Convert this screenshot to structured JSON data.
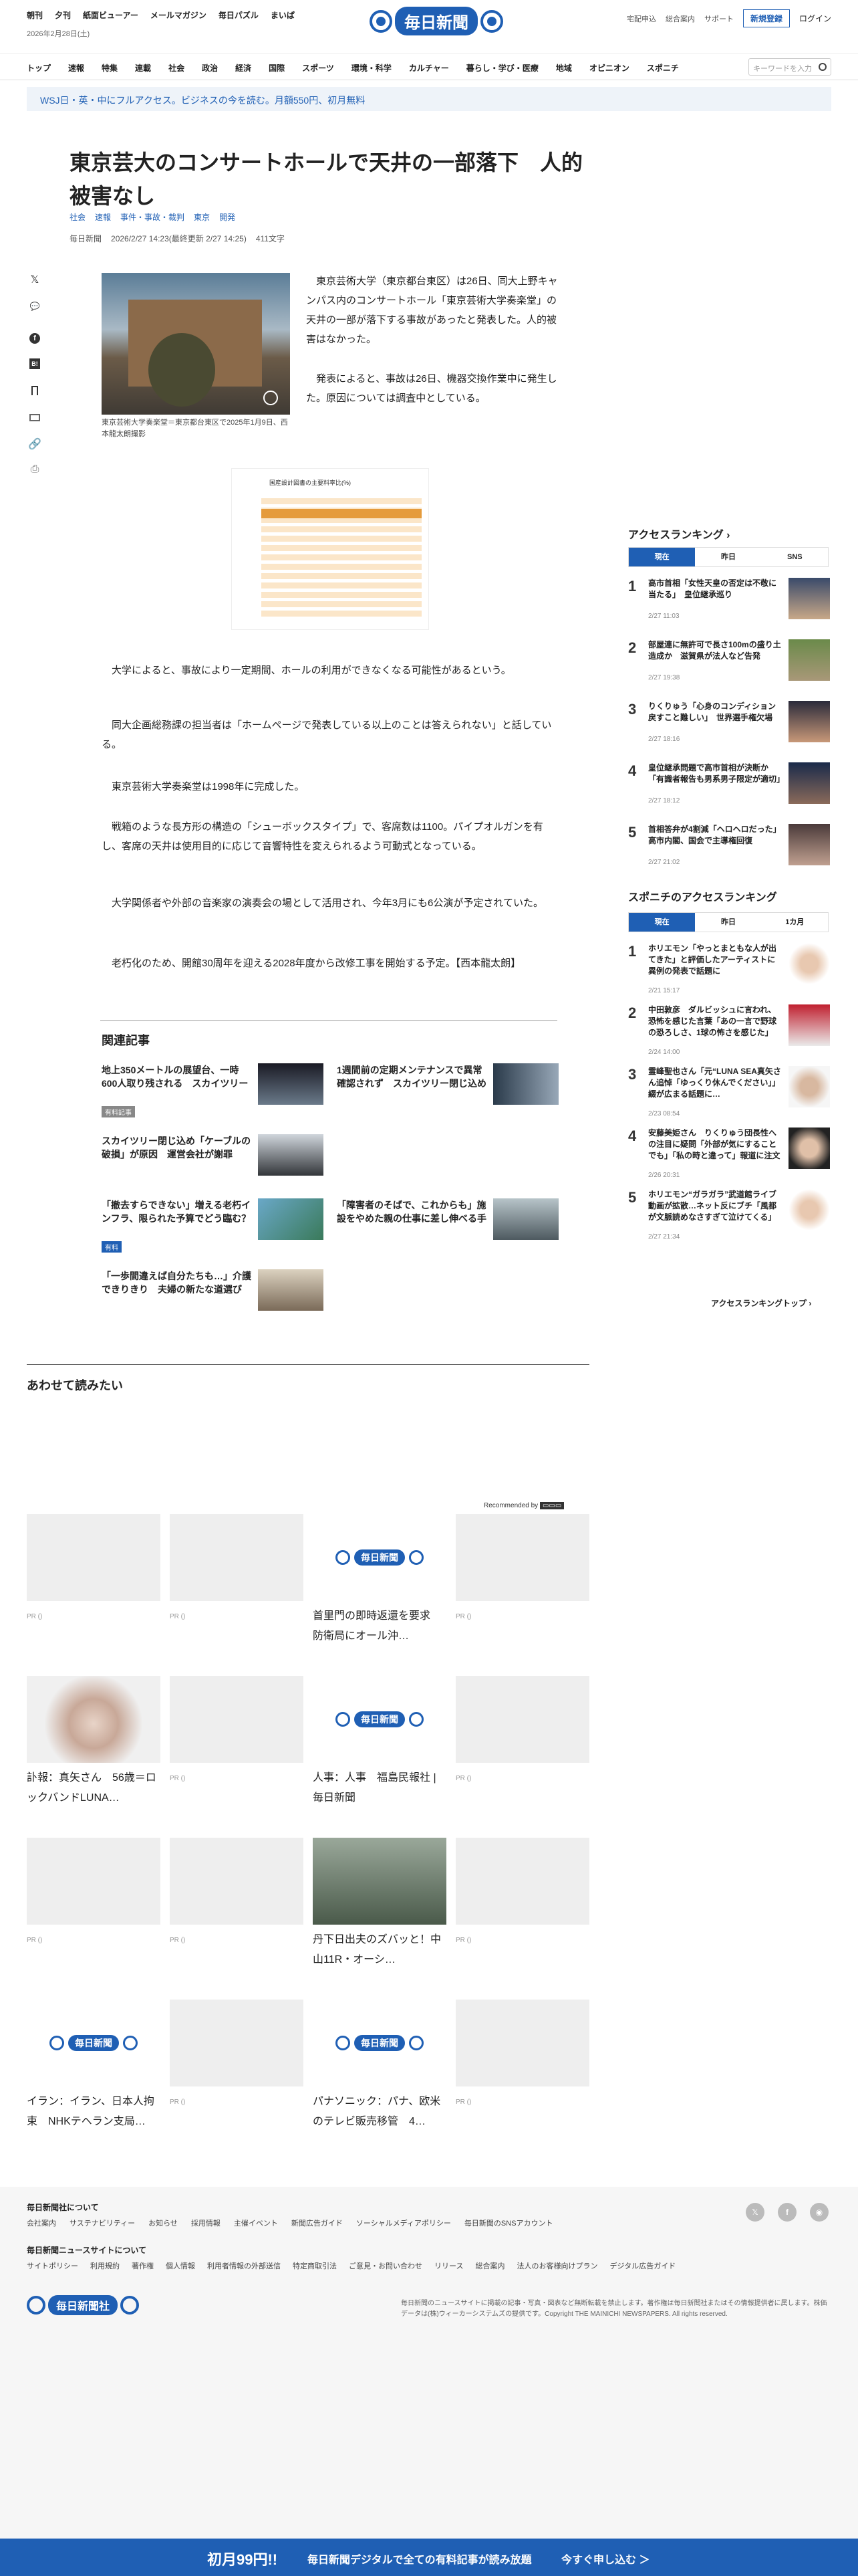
{
  "header": {
    "top_links": [
      "朝刊",
      "夕刊",
      "紙面ビューアー",
      "メールマガジン",
      "毎日パズル",
      "まいぱ"
    ],
    "date": "2026年2月28日(土)",
    "logo_text": "毎日新聞",
    "right_links": [
      "宅配申込",
      "総合案内",
      "サポート"
    ],
    "register": "新規登録",
    "login": "ログイン"
  },
  "nav": {
    "items": [
      "トップ",
      "速報",
      "特集",
      "連載",
      "社会",
      "政治",
      "経済",
      "国際",
      "スポーツ",
      "環境・科学",
      "カルチャー",
      "暮らし・学び・医療",
      "地域",
      "オピニオン",
      "スポニチ"
    ],
    "search_placeholder": "キーワードを入力"
  },
  "banner": "WSJ日・英・中にフルアクセス。ビジネスの今を読む。月額550円、初月無料",
  "article": {
    "title": "東京芸大のコンサートホールで天井の一部落下　人的被害なし",
    "tags": [
      "社会",
      "速報",
      "事件・事故・裁判",
      "東京",
      "開発"
    ],
    "meta": [
      "毎日新聞",
      "2026/2/27 14:23(最終更新 2/27 14:25)",
      "411文字"
    ],
    "share_icons": [
      "x-icon",
      "comment-icon",
      "facebook-icon",
      "hatena-icon",
      "bookmark-icon",
      "mail-icon",
      "link-icon",
      "print-icon"
    ],
    "photo_caption": "東京芸術大学奏楽堂＝東京都台東区で2025年1月9日、西本龍太朗撮影",
    "lead": "　東京芸術大学（東京都台東区）は26日、同大上野キャンパス内のコンサートホール「東京芸術大学奏楽堂」の天井の一部が落下する事故があったと発表した。人的被害はなかった。",
    "p2": "　発表によると、事故は26日、機器交換作業中に発生した。原因については調査中としている。",
    "table_title": "国産設計図書の主要料率比(%)",
    "body": [
      "　大学によると、事故により一定期間、ホールの利用ができなくなる可能性があるという。",
      "　同大企画総務課の担当者は「ホームページで発表している以上のことは答えられない」と話している。",
      "　東京芸術大学奏楽堂は1998年に完成した。",
      "　戦箱のような長方形の構造の「シューボックスタイプ」で、客席数は1100。パイプオルガンを有し、客席の天井は使用目的に応じて音響特性を変えられるよう可動式となっている。",
      "　大学関係者や外部の音楽家の演奏会の場として活用され、今年3月にも6公演が予定されていた。",
      "　老朽化のため、開館30周年を迎える2028年度から改修工事を開始する予定。【西本龍太朗】"
    ]
  },
  "related": {
    "heading": "関連記事",
    "items": [
      {
        "title": "地上350メートルの展望台、一時600人取り残される　スカイツリー",
        "badge": "有料記事"
      },
      {
        "title": "1週間前の定期メンテナンスで異常確認されず　スカイツリー閉じ込め",
        "badge": ""
      },
      {
        "title": "スカイツリー閉じ込め「ケーブルの破損」が原因　運営会社が謝罪",
        "badge": ""
      },
      {
        "title": "「撤去すらできない」増える老朽インフラ、限られた予算でどう臨む？",
        "badge": "有料"
      },
      {
        "title": "「障害者のそばで、これからも」施設をやめた親の仕事に差し伸べる手",
        "badge": ""
      },
      {
        "title": "「一歩間違えば自分たちも…」介護できりきり　夫婦の新たな道選び",
        "badge": ""
      }
    ]
  },
  "recommend": {
    "heading": "あわせて読みたい",
    "powered": "Recommended by",
    "cards": [
      {
        "title": "",
        "pr": "PR ()",
        "kind": "blank"
      },
      {
        "title": "",
        "pr": "PR ()",
        "kind": "blank"
      },
      {
        "title": "首里門の即時返還を要求　防衛局にオール沖…",
        "pr": "",
        "kind": "logo"
      },
      {
        "title": "",
        "pr": "PR ()",
        "kind": "blank"
      },
      {
        "title": "訃報：真矢さん　56歳＝ロックバンドLUNA…",
        "pr": "",
        "kind": "photo-man"
      },
      {
        "title": "",
        "pr": "PR ()",
        "kind": "blank"
      },
      {
        "title": "人事：人事　福島民報社 | 毎日新聞",
        "pr": "",
        "kind": "logo"
      },
      {
        "title": "",
        "pr": "PR ()",
        "kind": "blank"
      },
      {
        "title": "",
        "pr": "PR ()",
        "kind": "blank"
      },
      {
        "title": "",
        "pr": "PR ()",
        "kind": "blank"
      },
      {
        "title": "丹下日出夫のズバッと！中山11R・オーシ…",
        "pr": "",
        "kind": "photo-horse"
      },
      {
        "title": "",
        "pr": "PR ()",
        "kind": "blank"
      },
      {
        "title": "イラン：イラン、日本人拘束　NHKテヘラン支局…",
        "pr": "",
        "kind": "logo"
      },
      {
        "title": "",
        "pr": "PR ()",
        "kind": "blank"
      },
      {
        "title": "パナソニック：パナ、欧米のテレビ販売移管　4…",
        "pr": "",
        "kind": "logo"
      },
      {
        "title": "",
        "pr": "PR ()",
        "kind": "blank"
      }
    ]
  },
  "sidebar": {
    "access_heading": "アクセスランキング",
    "access_tabs": [
      "現在",
      "昨日",
      "SNS"
    ],
    "access_items": [
      {
        "n": "1",
        "title": "高市首相「女性天皇の否定は不敬に当たる」　皇位継承巡り",
        "date": "2/27 11:03"
      },
      {
        "n": "2",
        "title": "部屋連に無許可で長さ100mの盛り土造成か　滋賀県が法人など告発",
        "date": "2/27 19:38"
      },
      {
        "n": "3",
        "title": "りくりゅう「心身のコンディション戻すこと難しい」　世界選手権欠場",
        "date": "2/27 18:16"
      },
      {
        "n": "4",
        "title": "皇位継承問題で高市首相が決断か「有識者報告も男系男子限定が適切」",
        "date": "2/27 18:12"
      },
      {
        "n": "5",
        "title": "首相答弁が4割減「ヘロヘロだった」高市内閣、国会で主導権回復",
        "date": "2/27 21:02"
      }
    ],
    "sponichi_heading": "スポニチのアクセスランキング",
    "sponichi_tabs": [
      "現在",
      "昨日",
      "1カ月"
    ],
    "sponichi_items": [
      {
        "n": "1",
        "title": "ホリエモン「やっとまともな人が出てきた」と評価したアーティストに異例の発表で話題に",
        "date": "2/21 15:17"
      },
      {
        "n": "2",
        "title": "中田敦彦　ダルビッシュに言われ、恐怖を感じた言葉「あの一言で野球の恐ろしさ、1球の怖さを感じた」",
        "date": "2/24 14:00"
      },
      {
        "n": "3",
        "title": "霊峰聖也さん「元“LUNA SEA真矢さん追悼「ゆっくり休んでください」」綴が広まる話題に…",
        "date": "2/23 08:54"
      },
      {
        "n": "4",
        "title": "安藤美姫さん　りくりゅう団長性への注目に疑問「外部が気にすることでも」「私の時と違って」報道に注文",
        "date": "2/26 20:31"
      },
      {
        "n": "5",
        "title": "ホリエモン“ガラガラ”武道館ライブ動画が拡散…ネット反にブチ「風都が文脈読めなさすぎて泣けてくる」",
        "date": "2/27 21:34"
      }
    ],
    "ranking_top": "アクセスランキングトップ"
  },
  "footer": {
    "about_heading": "毎日新聞社について",
    "about_links": [
      "会社案内",
      "サステナビリティー",
      "お知らせ",
      "採用情報",
      "主催イベント",
      "新聞広告ガイド",
      "ソーシャルメディアポリシー",
      "毎日新聞のSNSアカウント"
    ],
    "site_heading": "毎日新聞ニュースサイトについて",
    "site_links": [
      "サイトポリシー",
      "利用規約",
      "著作権",
      "個人情報",
      "利用者情報の外部送信",
      "特定商取引法",
      "ご意見・お問い合わせ",
      "リリース",
      "総合案内",
      "法人のお客様向けプラン",
      "デジタル広告ガイド"
    ],
    "company_logo": "毎日新聞社",
    "note": "毎日新聞のニュースサイトに掲載の記事・写真・図表など無断転載を禁止します。著作権は毎日新聞社またはその情報提供者に属します。株価データは(株)ウィーカーシステムズの提供です。Copyright THE MAINICHI NEWSPAPERS. All rights reserved.",
    "copyright": "Copyright THE MAINICHI NEWSPAPERS. All rights reserved.",
    "social": [
      "x-icon",
      "facebook-icon",
      "rss-icon"
    ]
  },
  "bottom_bar": {
    "price": "初月99円!!",
    "text": "毎日新聞デジタルで全ての有料記事が読み放題",
    "cta": "今すぐ申し込む ＞"
  },
  "colors": {
    "brand": "#1f5fb4",
    "bg": "#ffffff",
    "footer": "#f6f6f6"
  }
}
